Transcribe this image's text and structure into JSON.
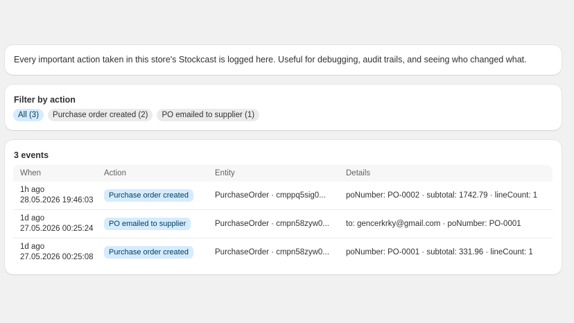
{
  "intro": {
    "text": "Every important action taken in this store's Stockcast is logged here. Useful for debugging, audit trails, and seeing who changed what."
  },
  "filter": {
    "title": "Filter by action",
    "chips": [
      {
        "label": "All (3)",
        "active": true
      },
      {
        "label": "Purchase order created (2)",
        "active": false
      },
      {
        "label": "PO emailed to supplier (1)",
        "active": false
      }
    ]
  },
  "events": {
    "title": "3 events",
    "columns": {
      "when": "When",
      "action": "Action",
      "entity": "Entity",
      "details": "Details"
    },
    "rows": [
      {
        "relative": "1h ago",
        "timestamp": "28.05.2026 19:46:03",
        "action": "Purchase order created",
        "entity": "PurchaseOrder · cmppq5sig0...",
        "details": "poNumber: PO-0002 · subtotal: 1742.79 · lineCount: 1"
      },
      {
        "relative": "1d ago",
        "timestamp": "27.05.2026 00:25:24",
        "action": "PO emailed to supplier",
        "entity": "PurchaseOrder · cmpn58zyw0...",
        "details": "to: gencerkrky@gmail.com · poNumber: PO-0001"
      },
      {
        "relative": "1d ago",
        "timestamp": "27.05.2026 00:25:08",
        "action": "Purchase order created",
        "entity": "PurchaseOrder · cmpn58zyw0...",
        "details": "poNumber: PO-0001 · subtotal: 331.96 · lineCount: 1"
      }
    ]
  },
  "colors": {
    "background": "#f1f1f1",
    "card": "#ffffff",
    "badge_bg": "#d5ebff",
    "badge_text": "#003a5a",
    "chip_bg": "#ebebeb"
  }
}
